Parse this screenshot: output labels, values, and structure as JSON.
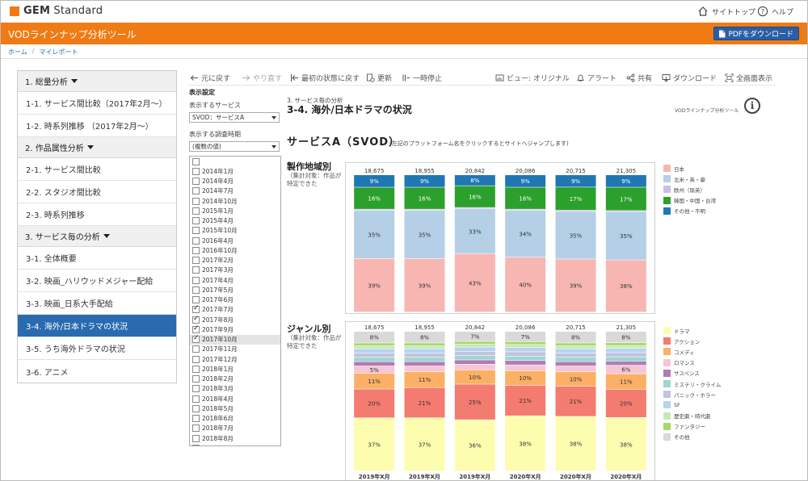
{
  "brand": {
    "name_bold": "GEM",
    "name_rest": " Standard"
  },
  "top_links": {
    "site_top": "サイトトップ",
    "help": "ヘルプ"
  },
  "header": {
    "title": "VODラインナップ分析ツール",
    "pdf_button": "PDFをダウンロード"
  },
  "breadcrumb": {
    "home": "ホーム",
    "sep": "/",
    "my_report": "マイレポート"
  },
  "nav": {
    "sections": [
      {
        "label": "1. 総量分析",
        "items": [
          "1-1. サービス間比較（2017年2月～）",
          "1-2. 時系列推移 （2017年2月～）"
        ]
      },
      {
        "label": "2. 作品属性分析",
        "items": [
          "2-1. サービス間比較",
          "2-2. スタジオ間比較",
          "2-3. 時系列推移"
        ]
      },
      {
        "label": "3. サービス毎の分析",
        "items": [
          "3-1. 全体概要",
          "3-2. 映画_ハリウッドメジャー配給",
          "3-3. 映画_日系大手配給",
          "3-4. 海外/日本ドラマの状況",
          "3-5. うち海外ドラマの状況",
          "3-6. アニメ"
        ]
      }
    ],
    "active": "3-4. 海外/日本ドラマの状況"
  },
  "toolbar": {
    "undo": "元に戻す",
    "redo": "やり直す",
    "reset": "最初の状態に戻す",
    "refresh": "更新",
    "pause": "一時停止",
    "view": "ビュー: オリジナル",
    "alert": "アラート",
    "share": "共有",
    "download": "ダウンロード",
    "fullscreen": "全画面表示"
  },
  "settings": {
    "heading": "表示設定",
    "service_label": "表示するサービス",
    "service_value": "SVOD：サービスA",
    "period_label": "表示する調査時期",
    "period_value": "(複数の値)",
    "periods": [
      {
        "label": "",
        "checked": false
      },
      {
        "label": "2014年1月",
        "checked": false
      },
      {
        "label": "2014年4月",
        "checked": false
      },
      {
        "label": "2014年7月",
        "checked": false
      },
      {
        "label": "2014年10月",
        "checked": false
      },
      {
        "label": "2015年1月",
        "checked": false
      },
      {
        "label": "2015年4月",
        "checked": false
      },
      {
        "label": "2015年10月",
        "checked": false
      },
      {
        "label": "2016年4月",
        "checked": false
      },
      {
        "label": "2016年10月",
        "checked": false
      },
      {
        "label": "2017年2月",
        "checked": false
      },
      {
        "label": "2017年3月",
        "checked": false
      },
      {
        "label": "2017年4月",
        "checked": false
      },
      {
        "label": "2017年5月",
        "checked": false
      },
      {
        "label": "2017年6月",
        "checked": false
      },
      {
        "label": "2017年7月",
        "checked": true
      },
      {
        "label": "2017年8月",
        "checked": true
      },
      {
        "label": "2017年9月",
        "checked": true
      },
      {
        "label": "2017年10月",
        "checked": true,
        "highlight": true
      },
      {
        "label": "2017年11月",
        "checked": false
      },
      {
        "label": "2017年12月",
        "checked": false
      },
      {
        "label": "2018年1月",
        "checked": false
      },
      {
        "label": "2018年2月",
        "checked": false
      },
      {
        "label": "2018年3月",
        "checked": false
      },
      {
        "label": "2018年4月",
        "checked": false
      },
      {
        "label": "2018年5月",
        "checked": false
      },
      {
        "label": "2018年6月",
        "checked": false
      },
      {
        "label": "2018年7月",
        "checked": false
      },
      {
        "label": "2018年8月",
        "checked": false
      },
      {
        "label": "2018年9月",
        "checked": false
      }
    ]
  },
  "main": {
    "crumb": "3. サービス毎の分析",
    "title": "3-4. 海外/日本ドラマの状況",
    "tool_name": "VODラインナップ分析ツール",
    "info": "i",
    "service_title": "サービスA（SVOD）",
    "service_note": "(左記のプラットフォーム名をクリックするとサイトへジャンプします)",
    "section1": {
      "title": "製作地域別",
      "note": "（集計対象：作品が特定できた"
    },
    "section2": {
      "title": "ジャンル別",
      "note": "（集計対象：作品が特定できた"
    }
  },
  "chart_data": [
    {
      "type": "bar",
      "stacked": true,
      "title": "製作地域別",
      "categories": [
        "2019年X月",
        "2019年X月",
        "2019年X月",
        "2020年X月",
        "2020年X月",
        "2020年X月"
      ],
      "totals": [
        18675,
        18955,
        20842,
        20086,
        20715,
        21305
      ],
      "unit": "%",
      "series": [
        {
          "name": "日本",
          "color": "#f7b6b2",
          "values": [
            39,
            39,
            43,
            40,
            39,
            38
          ],
          "labels": [
            "39%",
            "39%",
            "43%",
            "40%",
            "39%",
            "38%"
          ]
        },
        {
          "name": "北米・英・豪",
          "color": "#b4cfe6",
          "values": [
            35,
            35,
            33,
            34,
            35,
            35
          ],
          "labels": [
            "35%",
            "35%",
            "33%",
            "34%",
            "35%",
            "35%"
          ]
        },
        {
          "name": "欧州（除英）",
          "color": "#c9c0e0",
          "values": [
            1,
            1,
            1,
            1,
            1,
            1
          ],
          "labels": [
            "",
            "",
            "",
            "",
            "",
            ""
          ]
        },
        {
          "name": "韓国・中国・台湾",
          "color": "#2ca02c",
          "values": [
            16,
            16,
            16,
            16,
            17,
            17
          ],
          "labels": [
            "16%",
            "16%",
            "16%",
            "16%",
            "17%",
            "17%"
          ]
        },
        {
          "name": "その他・不明",
          "color": "#1f77b4",
          "values": [
            9,
            9,
            8,
            9,
            9,
            9
          ],
          "labels": [
            "9%",
            "9%",
            "8%",
            "9%",
            "9%",
            "9%"
          ]
        }
      ]
    },
    {
      "type": "bar",
      "stacked": true,
      "title": "ジャンル別",
      "categories": [
        "2019年X月",
        "2019年X月",
        "2019年X月",
        "2020年X月",
        "2020年X月",
        "2020年X月"
      ],
      "totals": [
        18675,
        18955,
        20842,
        20086,
        20715,
        21305
      ],
      "unit": "%",
      "series": [
        {
          "name": "ドラマ",
          "color": "#fdfdb0",
          "values": [
            37,
            37,
            36,
            38,
            38,
            38
          ],
          "labels": [
            "37%",
            "37%",
            "36%",
            "38%",
            "38%",
            "38%"
          ]
        },
        {
          "name": "アクション",
          "color": "#f47b6f",
          "values": [
            20,
            21,
            25,
            21,
            21,
            20
          ],
          "labels": [
            "20%",
            "21%",
            "25%",
            "21%",
            "21%",
            "20%"
          ]
        },
        {
          "name": "コメディ",
          "color": "#fbb065",
          "values": [
            11,
            11,
            10,
            10,
            10,
            11
          ],
          "labels": [
            "11%",
            "11%",
            "10%",
            "10%",
            "10%",
            "11%"
          ]
        },
        {
          "name": "ロマンス",
          "color": "#f6c6d6",
          "values": [
            5,
            4,
            4,
            4,
            4,
            6
          ],
          "labels": [
            "5%",
            "",
            "",
            "",
            "",
            "6%"
          ]
        },
        {
          "name": "サスペンス",
          "color": "#b07cb5",
          "values": [
            3,
            3,
            3,
            3,
            3,
            3
          ],
          "labels": [
            "",
            "",
            "",
            "",
            "",
            ""
          ]
        },
        {
          "name": "ミステリ・クライム",
          "color": "#9ed6d0",
          "values": [
            3,
            3,
            3,
            3,
            3,
            3
          ],
          "labels": [
            "",
            "",
            "",
            "",
            "",
            ""
          ]
        },
        {
          "name": "パニック・ホラー",
          "color": "#c0c4e0",
          "values": [
            3,
            3,
            3,
            3,
            3,
            3
          ],
          "labels": [
            "",
            "",
            "",
            "",
            "",
            ""
          ]
        },
        {
          "name": "SF",
          "color": "#b7d3ee",
          "values": [
            3,
            3,
            3,
            3,
            3,
            3
          ],
          "labels": [
            "",
            "",
            "",
            "",
            "",
            ""
          ]
        },
        {
          "name": "歴史劇・時代劇",
          "color": "#c9e7b6",
          "values": [
            2,
            2,
            2,
            2,
            2,
            2
          ],
          "labels": [
            "",
            "",
            "",
            "",
            "",
            ""
          ]
        },
        {
          "name": "ファンタジー",
          "color": "#a6d96a",
          "values": [
            2,
            2,
            2,
            2,
            2,
            2
          ],
          "labels": [
            "",
            "",
            "",
            "",
            "",
            ""
          ]
        },
        {
          "name": "その他",
          "color": "#d9d9d9",
          "values": [
            8,
            8,
            7,
            7,
            8,
            8
          ],
          "labels": [
            "8%",
            "8%",
            "7%",
            "7%",
            "8%",
            "8%"
          ]
        }
      ]
    }
  ]
}
